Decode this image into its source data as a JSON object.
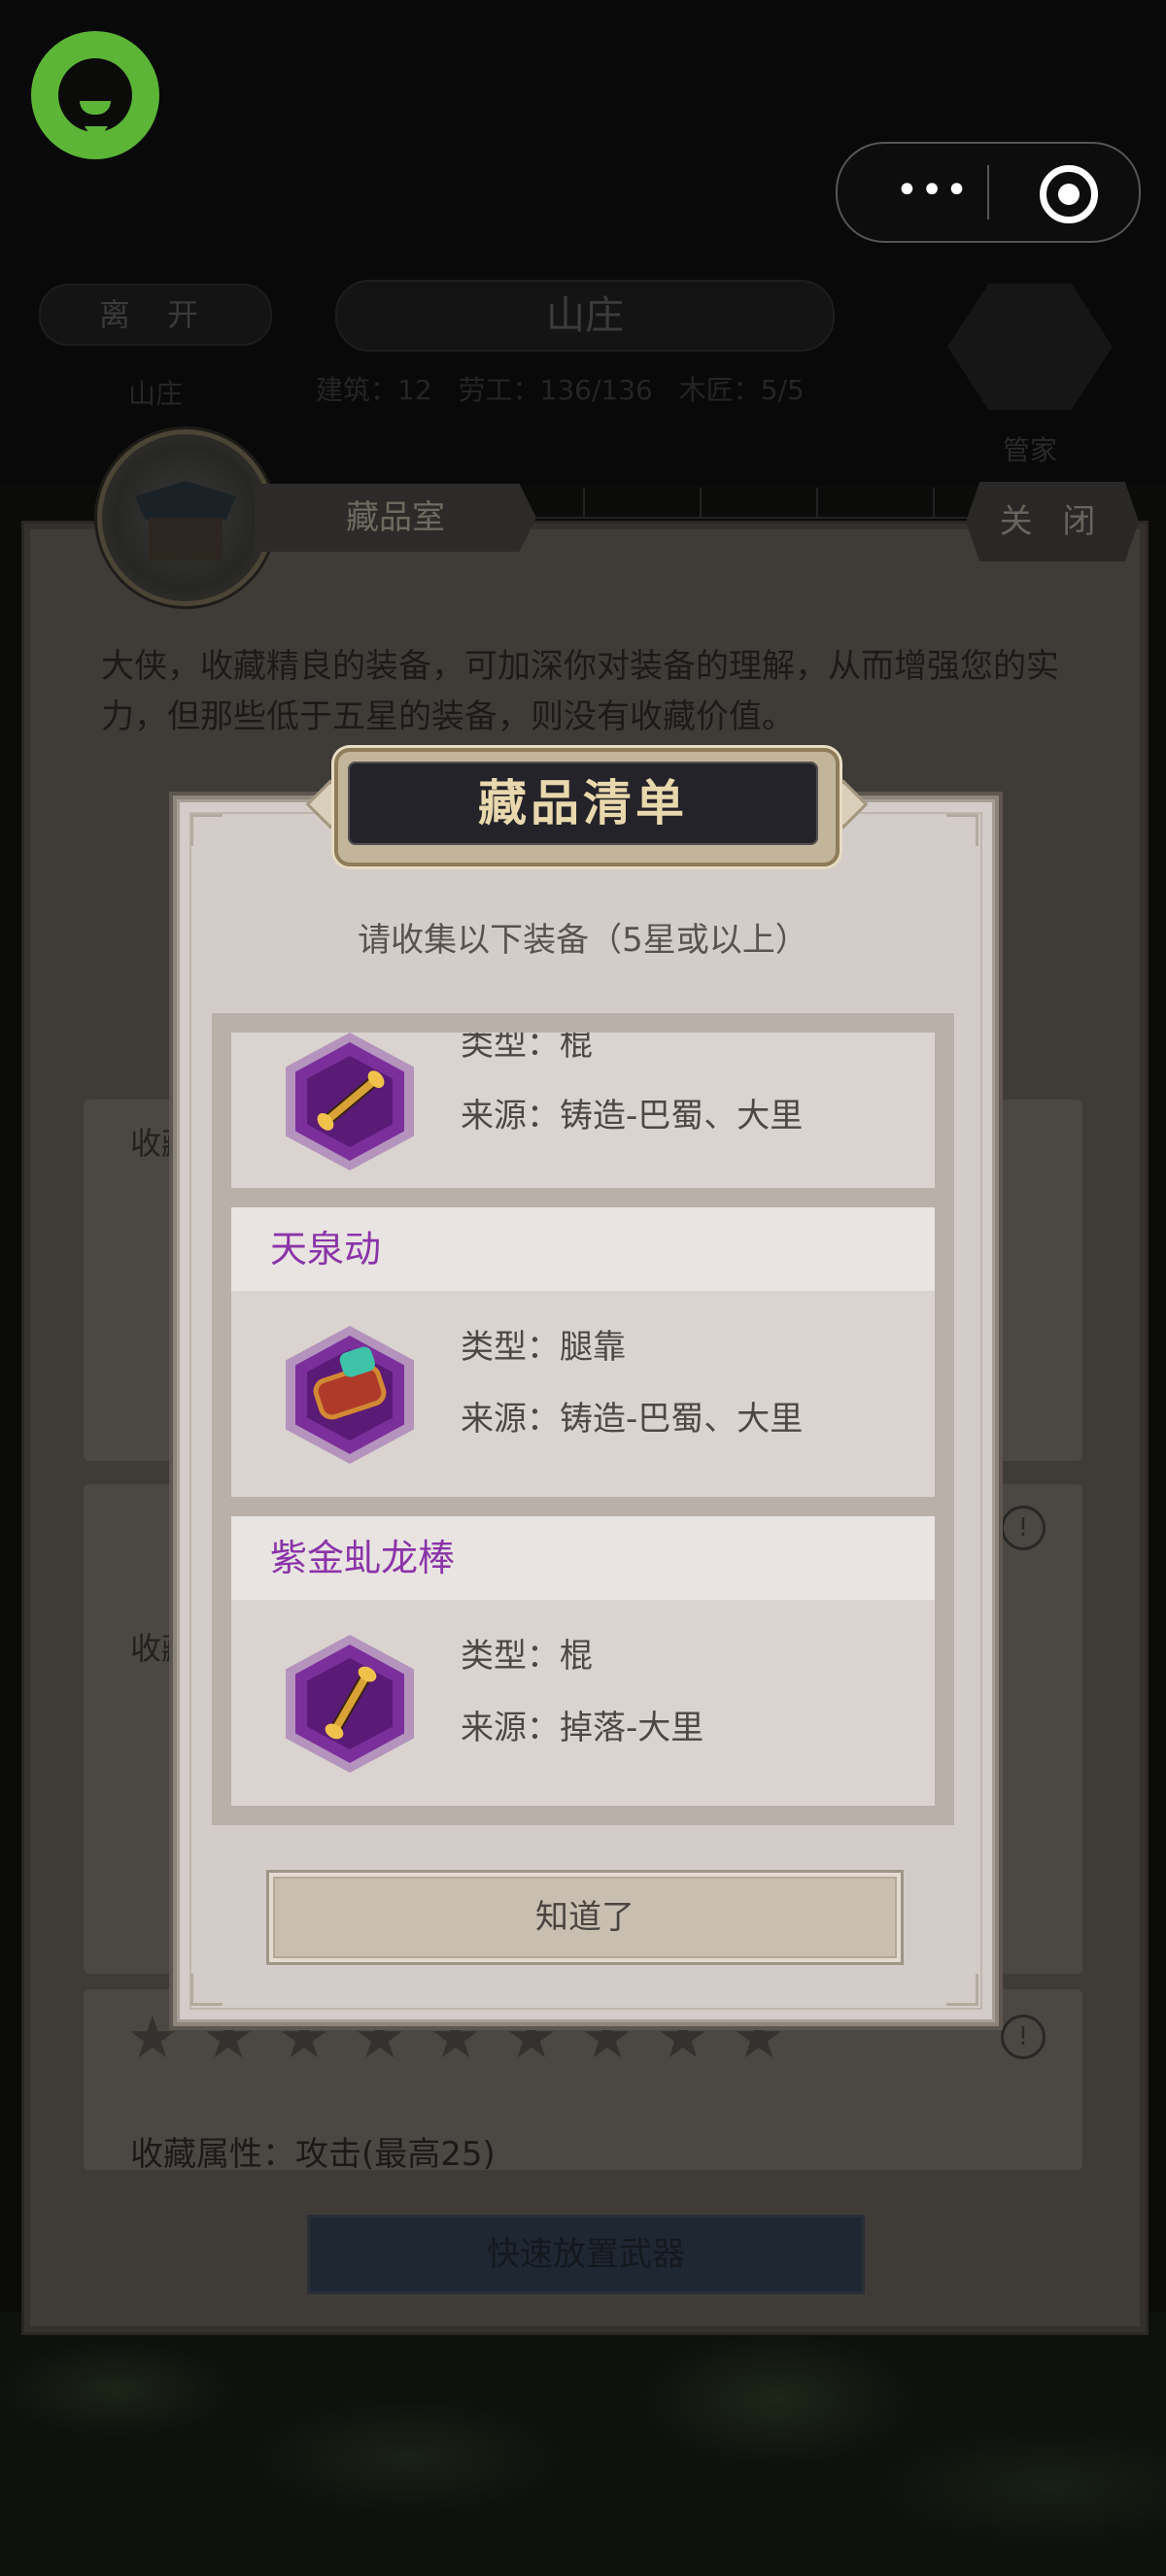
{
  "system": {
    "capsule_more": "•••"
  },
  "header": {
    "leave_label": "离 开",
    "villa_title": "山庄",
    "villa_sub": "山庄",
    "stats": [
      "建筑：12",
      "劳工：136/136",
      "木匠：5/5"
    ],
    "steward_label": "管家"
  },
  "room": {
    "name": "藏品室",
    "close_label": "关 闭",
    "intro": "大侠，收藏精良的装备，可加深你对装备的理解，从而增强您的实力，但那些低于五星的装备，则没有收藏价值。",
    "card_label_1": "收藏",
    "card_label_2": "收藏",
    "stars": [
      "★",
      "★",
      "★",
      "★",
      "★",
      "★",
      "★",
      "★",
      "★"
    ],
    "info_icon": "!",
    "collect_attr": "收藏属性：攻击(最高25)",
    "quick_place_label": "快速放置武器"
  },
  "modal": {
    "title": "藏品清单",
    "subtitle": "请收集以下装备（5星或以上）",
    "items": [
      {
        "name": "",
        "type": "类型：棍",
        "source": "来源：铸造-巴蜀、大里",
        "icon": "staff-icon"
      },
      {
        "name": "天泉动",
        "type": "类型：腿靠",
        "source": "来源：铸造-巴蜀、大里",
        "icon": "shin-guard-icon"
      },
      {
        "name": "紫金虬龙棒",
        "type": "类型：棍",
        "source": "来源：掉落-大里",
        "icon": "staff-icon"
      }
    ],
    "confirm_label": "知道了"
  },
  "colors": {
    "item_name_purple": "#8a34a8",
    "title_gold": "#e9d8ad",
    "miniapp_green": "#5cb537"
  }
}
